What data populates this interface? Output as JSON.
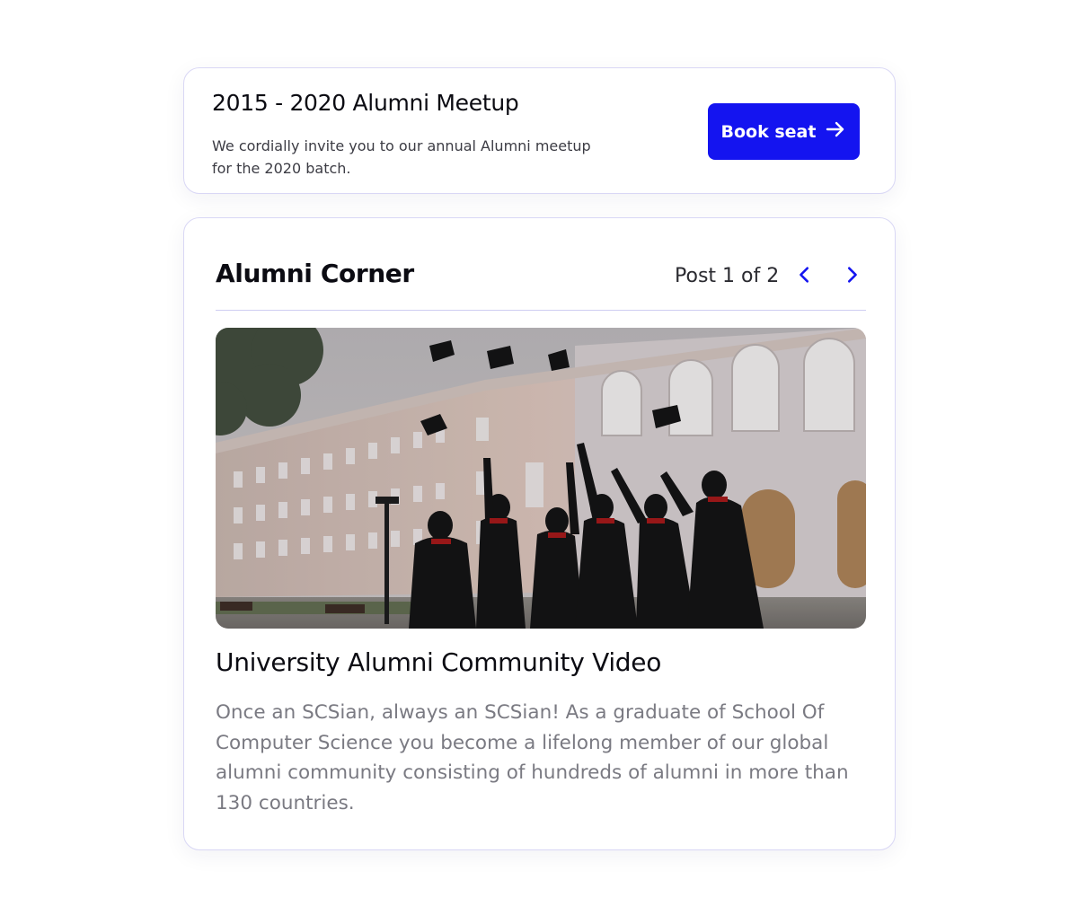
{
  "event": {
    "title": "2015 - 2020 Alumni Meetup",
    "description": "We cordially invite you to our annual Alumni meetup for the 2020 batch.",
    "button_label": "Book seat",
    "button_icon": "arrow-right-icon"
  },
  "alumni_corner": {
    "title": "Alumni Corner",
    "post_counter": "Post 1 of 2",
    "prev_icon": "chevron-left-icon",
    "next_icon": "chevron-right-icon",
    "post": {
      "image_alt": "Graduates in gowns throwing caps in front of a university building",
      "title": "University Alumni Community Video",
      "body": "Once an SCSian, always an SCSian! As a graduate of School Of Computer Science you become a lifelong member of our global alumni community consisting of hundreds of alumni in more than 130 countries."
    }
  },
  "colors": {
    "accent": "#1414f0",
    "card_border": "#d9d7f5",
    "body_text": "#7a7a82"
  }
}
